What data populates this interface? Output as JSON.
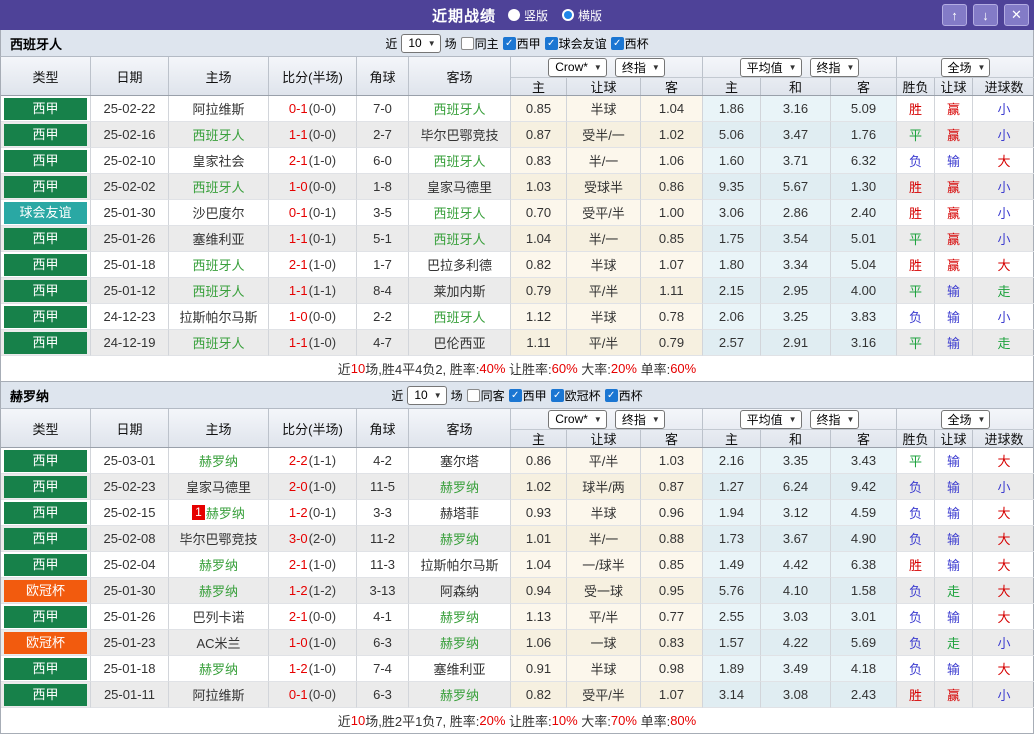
{
  "titlebar": {
    "title": "近期战绩",
    "radios": [
      {
        "label": "竖版",
        "selected": false
      },
      {
        "label": "横版",
        "selected": true
      }
    ],
    "buttons": {
      "up": "↑",
      "down": "↓",
      "close": "✕"
    }
  },
  "table": {
    "left_columns": [
      "类型",
      "日期",
      "主场",
      "比分(半场)",
      "角球",
      "客场"
    ],
    "selects": {
      "group1": [
        "Crow*",
        "终指"
      ],
      "group2": [
        "平均值",
        "终指"
      ],
      "group3": [
        "全场"
      ]
    },
    "sub_columns": [
      "主",
      "让球",
      "客",
      "主",
      "和",
      "客",
      "胜负",
      "让球",
      "进球数"
    ],
    "filter_near": "近",
    "filter_games": "场"
  },
  "colors": {
    "accent_purple": "#4e4298",
    "liga_badge": "#17814a",
    "friendly_badge": "#2aa8a4",
    "ucl_badge": "#f25b0e",
    "team_highlight": "#39a03c",
    "score_red": "#e60000",
    "result_red": "#d60000",
    "result_green": "#1ca23c",
    "result_blue": "#3d3dd0",
    "checkbox_blue": "#1b76d2"
  },
  "sections": [
    {
      "team": "西班牙人",
      "near_count": "10",
      "same": {
        "label": "同主",
        "checked": false
      },
      "leagues": [
        {
          "label": "西甲",
          "checked": true
        },
        {
          "label": "球会友谊",
          "checked": true
        },
        {
          "label": "西杯",
          "checked": true
        }
      ],
      "rows": [
        {
          "league": "西甲",
          "lc": "liga",
          "date": "25-02-22",
          "home": "阿拉维斯",
          "hh": false,
          "score": "0-1",
          "half": "(0-0)",
          "corner": "7-0",
          "away": "西班牙人",
          "ah": true,
          "odds": [
            "0.85",
            "半球",
            "1.04"
          ],
          "avg": [
            "1.86",
            "3.16",
            "5.09"
          ],
          "res": [
            [
              "胜",
              "r"
            ],
            [
              "赢",
              "r"
            ],
            [
              "小",
              "b"
            ]
          ]
        },
        {
          "league": "西甲",
          "lc": "liga",
          "date": "25-02-16",
          "home": "西班牙人",
          "hh": true,
          "score": "1-1",
          "half": "(0-0)",
          "corner": "2-7",
          "away": "毕尔巴鄂竞技",
          "ah": false,
          "odds": [
            "0.87",
            "受半/一",
            "1.02"
          ],
          "avg": [
            "5.06",
            "3.47",
            "1.76"
          ],
          "res": [
            [
              "平",
              "g"
            ],
            [
              "赢",
              "r"
            ],
            [
              "小",
              "b"
            ]
          ]
        },
        {
          "league": "西甲",
          "lc": "liga",
          "date": "25-02-10",
          "home": "皇家社会",
          "hh": false,
          "score": "2-1",
          "half": "(1-0)",
          "corner": "6-0",
          "away": "西班牙人",
          "ah": true,
          "odds": [
            "0.83",
            "半/一",
            "1.06"
          ],
          "avg": [
            "1.60",
            "3.71",
            "6.32"
          ],
          "res": [
            [
              "负",
              "b"
            ],
            [
              "输",
              "b"
            ],
            [
              "大",
              "r"
            ]
          ]
        },
        {
          "league": "西甲",
          "lc": "liga",
          "date": "25-02-02",
          "home": "西班牙人",
          "hh": true,
          "score": "1-0",
          "half": "(0-0)",
          "corner": "1-8",
          "away": "皇家马德里",
          "ah": false,
          "odds": [
            "1.03",
            "受球半",
            "0.86"
          ],
          "avg": [
            "9.35",
            "5.67",
            "1.30"
          ],
          "res": [
            [
              "胜",
              "r"
            ],
            [
              "赢",
              "r"
            ],
            [
              "小",
              "b"
            ]
          ]
        },
        {
          "league": "球会友谊",
          "lc": "friendly",
          "date": "25-01-30",
          "home": "沙巴度尔",
          "hh": false,
          "score": "0-1",
          "half": "(0-1)",
          "corner": "3-5",
          "away": "西班牙人",
          "ah": true,
          "odds": [
            "0.70",
            "受平/半",
            "1.00"
          ],
          "avg": [
            "3.06",
            "2.86",
            "2.40"
          ],
          "res": [
            [
              "胜",
              "r"
            ],
            [
              "赢",
              "r"
            ],
            [
              "小",
              "b"
            ]
          ]
        },
        {
          "league": "西甲",
          "lc": "liga",
          "date": "25-01-26",
          "home": "塞维利亚",
          "hh": false,
          "score": "1-1",
          "half": "(0-1)",
          "corner": "5-1",
          "away": "西班牙人",
          "ah": true,
          "odds": [
            "1.04",
            "半/一",
            "0.85"
          ],
          "avg": [
            "1.75",
            "3.54",
            "5.01"
          ],
          "res": [
            [
              "平",
              "g"
            ],
            [
              "赢",
              "r"
            ],
            [
              "小",
              "b"
            ]
          ]
        },
        {
          "league": "西甲",
          "lc": "liga",
          "date": "25-01-18",
          "home": "西班牙人",
          "hh": true,
          "score": "2-1",
          "half": "(1-0)",
          "corner": "1-7",
          "away": "巴拉多利德",
          "ah": false,
          "odds": [
            "0.82",
            "半球",
            "1.07"
          ],
          "avg": [
            "1.80",
            "3.34",
            "5.04"
          ],
          "res": [
            [
              "胜",
              "r"
            ],
            [
              "赢",
              "r"
            ],
            [
              "大",
              "r"
            ]
          ]
        },
        {
          "league": "西甲",
          "lc": "liga",
          "date": "25-01-12",
          "home": "西班牙人",
          "hh": true,
          "score": "1-1",
          "half": "(1-1)",
          "corner": "8-4",
          "away": "莱加内斯",
          "ah": false,
          "odds": [
            "0.79",
            "平/半",
            "1.11"
          ],
          "avg": [
            "2.15",
            "2.95",
            "4.00"
          ],
          "res": [
            [
              "平",
              "g"
            ],
            [
              "输",
              "b"
            ],
            [
              "走",
              "g"
            ]
          ]
        },
        {
          "league": "西甲",
          "lc": "liga",
          "date": "24-12-23",
          "home": "拉斯帕尔马斯",
          "hh": false,
          "score": "1-0",
          "half": "(0-0)",
          "corner": "2-2",
          "away": "西班牙人",
          "ah": true,
          "odds": [
            "1.12",
            "半球",
            "0.78"
          ],
          "avg": [
            "2.06",
            "3.25",
            "3.83"
          ],
          "res": [
            [
              "负",
              "b"
            ],
            [
              "输",
              "b"
            ],
            [
              "小",
              "b"
            ]
          ]
        },
        {
          "league": "西甲",
          "lc": "liga",
          "date": "24-12-19",
          "home": "西班牙人",
          "hh": true,
          "score": "1-1",
          "half": "(1-0)",
          "corner": "4-7",
          "away": "巴伦西亚",
          "ah": false,
          "odds": [
            "1.11",
            "平/半",
            "0.79"
          ],
          "avg": [
            "2.57",
            "2.91",
            "3.16"
          ],
          "res": [
            [
              "平",
              "g"
            ],
            [
              "输",
              "b"
            ],
            [
              "走",
              "g"
            ]
          ]
        }
      ],
      "summary": {
        "p0": "近",
        "n": "10",
        "p1": "场,胜4平4负2, 胜率:",
        "v1": "40%",
        "p2": " 让胜率:",
        "v2": "60%",
        "p3": " 大率:",
        "v3": "20%",
        "p4": " 单率:",
        "v4": "60%"
      }
    },
    {
      "team": "赫罗纳",
      "near_count": "10",
      "same": {
        "label": "同客",
        "checked": false
      },
      "leagues": [
        {
          "label": "西甲",
          "checked": true
        },
        {
          "label": "欧冠杯",
          "checked": true
        },
        {
          "label": "西杯",
          "checked": true
        }
      ],
      "rows": [
        {
          "league": "西甲",
          "lc": "liga",
          "date": "25-03-01",
          "home": "赫罗纳",
          "hh": true,
          "score": "2-2",
          "half": "(1-1)",
          "corner": "4-2",
          "away": "塞尔塔",
          "ah": false,
          "odds": [
            "0.86",
            "平/半",
            "1.03"
          ],
          "avg": [
            "2.16",
            "3.35",
            "3.43"
          ],
          "res": [
            [
              "平",
              "g"
            ],
            [
              "输",
              "b"
            ],
            [
              "大",
              "r"
            ]
          ]
        },
        {
          "league": "西甲",
          "lc": "liga",
          "date": "25-02-23",
          "home": "皇家马德里",
          "hh": false,
          "score": "2-0",
          "half": "(1-0)",
          "corner": "11-5",
          "away": "赫罗纳",
          "ah": true,
          "odds": [
            "1.02",
            "球半/两",
            "0.87"
          ],
          "avg": [
            "1.27",
            "6.24",
            "9.42"
          ],
          "res": [
            [
              "负",
              "b"
            ],
            [
              "输",
              "b"
            ],
            [
              "小",
              "b"
            ]
          ]
        },
        {
          "league": "西甲",
          "lc": "liga",
          "date": "25-02-15",
          "home": "赫罗纳",
          "hh": true,
          "hbadge": "1",
          "score": "1-2",
          "half": "(0-1)",
          "corner": "3-3",
          "away": "赫塔菲",
          "ah": false,
          "odds": [
            "0.93",
            "半球",
            "0.96"
          ],
          "avg": [
            "1.94",
            "3.12",
            "4.59"
          ],
          "res": [
            [
              "负",
              "b"
            ],
            [
              "输",
              "b"
            ],
            [
              "大",
              "r"
            ]
          ]
        },
        {
          "league": "西甲",
          "lc": "liga",
          "date": "25-02-08",
          "home": "毕尔巴鄂竞技",
          "hh": false,
          "score": "3-0",
          "half": "(2-0)",
          "corner": "11-2",
          "away": "赫罗纳",
          "ah": true,
          "odds": [
            "1.01",
            "半/一",
            "0.88"
          ],
          "avg": [
            "1.73",
            "3.67",
            "4.90"
          ],
          "res": [
            [
              "负",
              "b"
            ],
            [
              "输",
              "b"
            ],
            [
              "大",
              "r"
            ]
          ]
        },
        {
          "league": "西甲",
          "lc": "liga",
          "date": "25-02-04",
          "home": "赫罗纳",
          "hh": true,
          "score": "2-1",
          "half": "(1-0)",
          "corner": "11-3",
          "away": "拉斯帕尔马斯",
          "ah": false,
          "odds": [
            "1.04",
            "一/球半",
            "0.85"
          ],
          "avg": [
            "1.49",
            "4.42",
            "6.38"
          ],
          "res": [
            [
              "胜",
              "r"
            ],
            [
              "输",
              "b"
            ],
            [
              "大",
              "r"
            ]
          ]
        },
        {
          "league": "欧冠杯",
          "lc": "ucl",
          "date": "25-01-30",
          "home": "赫罗纳",
          "hh": true,
          "score": "1-2",
          "half": "(1-2)",
          "corner": "3-13",
          "away": "阿森纳",
          "ah": false,
          "odds": [
            "0.94",
            "受一球",
            "0.95"
          ],
          "avg": [
            "5.76",
            "4.10",
            "1.58"
          ],
          "res": [
            [
              "负",
              "b"
            ],
            [
              "走",
              "g"
            ],
            [
              "大",
              "r"
            ]
          ]
        },
        {
          "league": "西甲",
          "lc": "liga",
          "date": "25-01-26",
          "home": "巴列卡诺",
          "hh": false,
          "score": "2-1",
          "half": "(0-0)",
          "corner": "4-1",
          "away": "赫罗纳",
          "ah": true,
          "odds": [
            "1.13",
            "平/半",
            "0.77"
          ],
          "avg": [
            "2.55",
            "3.03",
            "3.01"
          ],
          "res": [
            [
              "负",
              "b"
            ],
            [
              "输",
              "b"
            ],
            [
              "大",
              "r"
            ]
          ]
        },
        {
          "league": "欧冠杯",
          "lc": "ucl",
          "date": "25-01-23",
          "home": "AC米兰",
          "hh": false,
          "score": "1-0",
          "half": "(1-0)",
          "corner": "6-3",
          "away": "赫罗纳",
          "ah": true,
          "odds": [
            "1.06",
            "一球",
            "0.83"
          ],
          "avg": [
            "1.57",
            "4.22",
            "5.69"
          ],
          "res": [
            [
              "负",
              "b"
            ],
            [
              "走",
              "g"
            ],
            [
              "小",
              "b"
            ]
          ]
        },
        {
          "league": "西甲",
          "lc": "liga",
          "date": "25-01-18",
          "home": "赫罗纳",
          "hh": true,
          "score": "1-2",
          "half": "(1-0)",
          "corner": "7-4",
          "away": "塞维利亚",
          "ah": false,
          "odds": [
            "0.91",
            "半球",
            "0.98"
          ],
          "avg": [
            "1.89",
            "3.49",
            "4.18"
          ],
          "res": [
            [
              "负",
              "b"
            ],
            [
              "输",
              "b"
            ],
            [
              "大",
              "r"
            ]
          ]
        },
        {
          "league": "西甲",
          "lc": "liga",
          "date": "25-01-11",
          "home": "阿拉维斯",
          "hh": false,
          "score": "0-1",
          "half": "(0-0)",
          "corner": "6-3",
          "away": "赫罗纳",
          "ah": true,
          "odds": [
            "0.82",
            "受平/半",
            "1.07"
          ],
          "avg": [
            "3.14",
            "3.08",
            "2.43"
          ],
          "res": [
            [
              "胜",
              "r"
            ],
            [
              "赢",
              "r"
            ],
            [
              "小",
              "b"
            ]
          ]
        }
      ],
      "summary": {
        "p0": "近",
        "n": "10",
        "p1": "场,胜2平1负7, 胜率:",
        "v1": "20%",
        "p2": " 让胜率:",
        "v2": "10%",
        "p3": " 大率:",
        "v3": "70%",
        "p4": " 单率:",
        "v4": "80%"
      }
    }
  ]
}
